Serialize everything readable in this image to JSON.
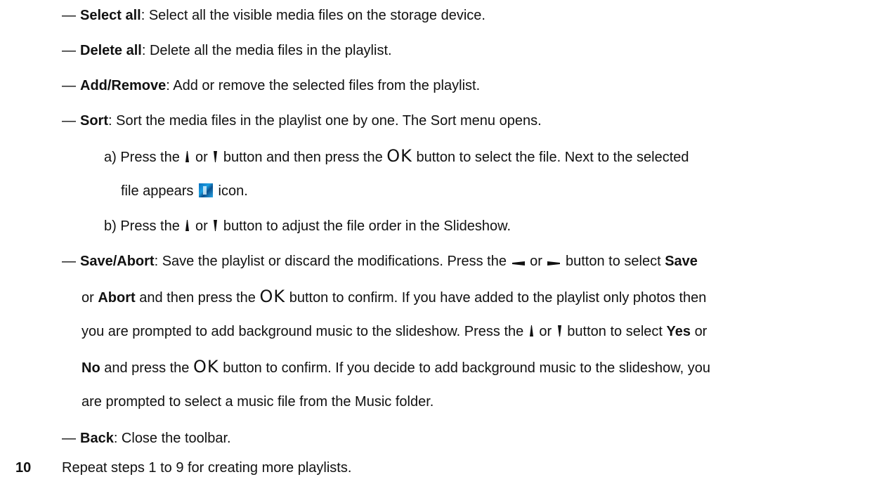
{
  "dash": "—",
  "items": {
    "select_all": {
      "term": "Select all",
      "desc": ": Select all the visible media files on the storage device."
    },
    "delete_all": {
      "term": "Delete all",
      "desc": ": Delete all the media files in the playlist."
    },
    "add_remove": {
      "term": "Add/Remove",
      "desc": ": Add or remove the selected files from the playlist."
    },
    "sort": {
      "term": "Sort",
      "desc": ": Sort the media files in the playlist one by one. The Sort menu opens."
    },
    "sort_a": {
      "part1": "a) Press the",
      "or": "or",
      "part2": "button and then press the",
      "ok": "OK",
      "part3": "button to select the file. Next to the selected",
      "part4": "file appears",
      "part5": "icon."
    },
    "sort_b": {
      "part1": "b) Press the",
      "or": "or",
      "part2": "button to adjust the file order in the Slideshow."
    },
    "save_abort": {
      "term": "Save/Abort",
      "l1_a": ": Save the playlist or discard the modifications. Press the",
      "l1_or": "or",
      "l1_b": "button to select",
      "l1_save": "Save",
      "l2_a": "or",
      "l2_abort": "Abort",
      "l2_b": "and then press the",
      "l2_ok": "OK",
      "l2_c": "button to confirm. If you have added to the playlist only photos then",
      "l3": "you are prompted to add background music to the slideshow. Press the",
      "l3_or": "or",
      "l3_b": "button to select",
      "l3_yes": "Yes",
      "l3_c": "or",
      "l4_no": "No",
      "l4_a": "and press the",
      "l4_ok": "OK",
      "l4_b": "button to confirm. If you decide to add background music to the slideshow, you",
      "l5": "are prompted to select a music file from the Music folder."
    },
    "back": {
      "term": "Back",
      "desc": ": Close the toolbar."
    }
  },
  "step": {
    "number": "10",
    "text": "Repeat steps 1 to 9 for creating more playlists."
  }
}
